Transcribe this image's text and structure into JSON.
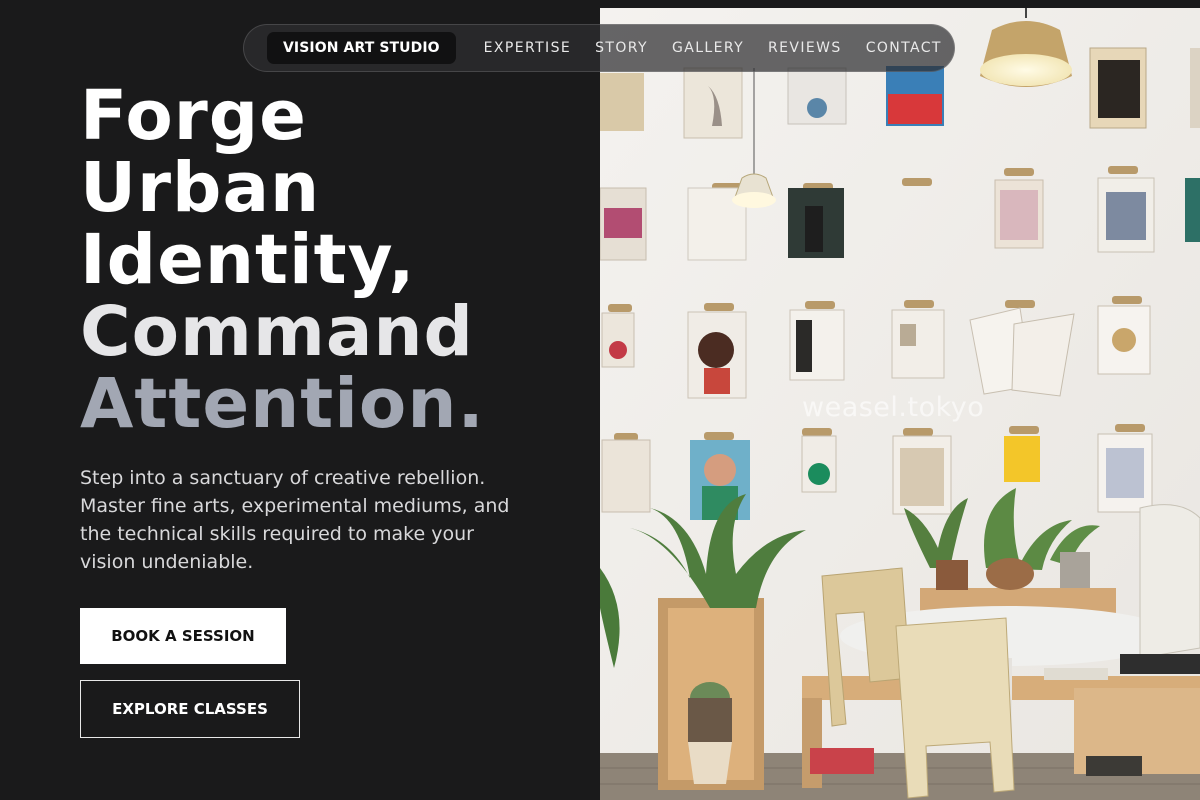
{
  "nav": {
    "brand": "VISION ART STUDIO",
    "links": [
      "EXPERTISE",
      "STORY",
      "GALLERY",
      "REVIEWS",
      "CONTACT"
    ]
  },
  "hero": {
    "headline": [
      "Forge",
      "Urban",
      "Identity,",
      "Command",
      "Attention."
    ],
    "description": "Step into a sanctuary of creative rebellion. Master fine arts, experimental mediums, and the technical skills required to make your vision undeniable.",
    "primary_cta": "BOOK A SESSION",
    "secondary_cta": "EXPLORE CLASSES",
    "image_watermark": "weasel.tokyo"
  },
  "colors": {
    "background": "#1a1a1b",
    "headline_primary": "#ffffff",
    "headline_muted": "#a2a7b3",
    "button_primary_bg": "#ffffff"
  }
}
